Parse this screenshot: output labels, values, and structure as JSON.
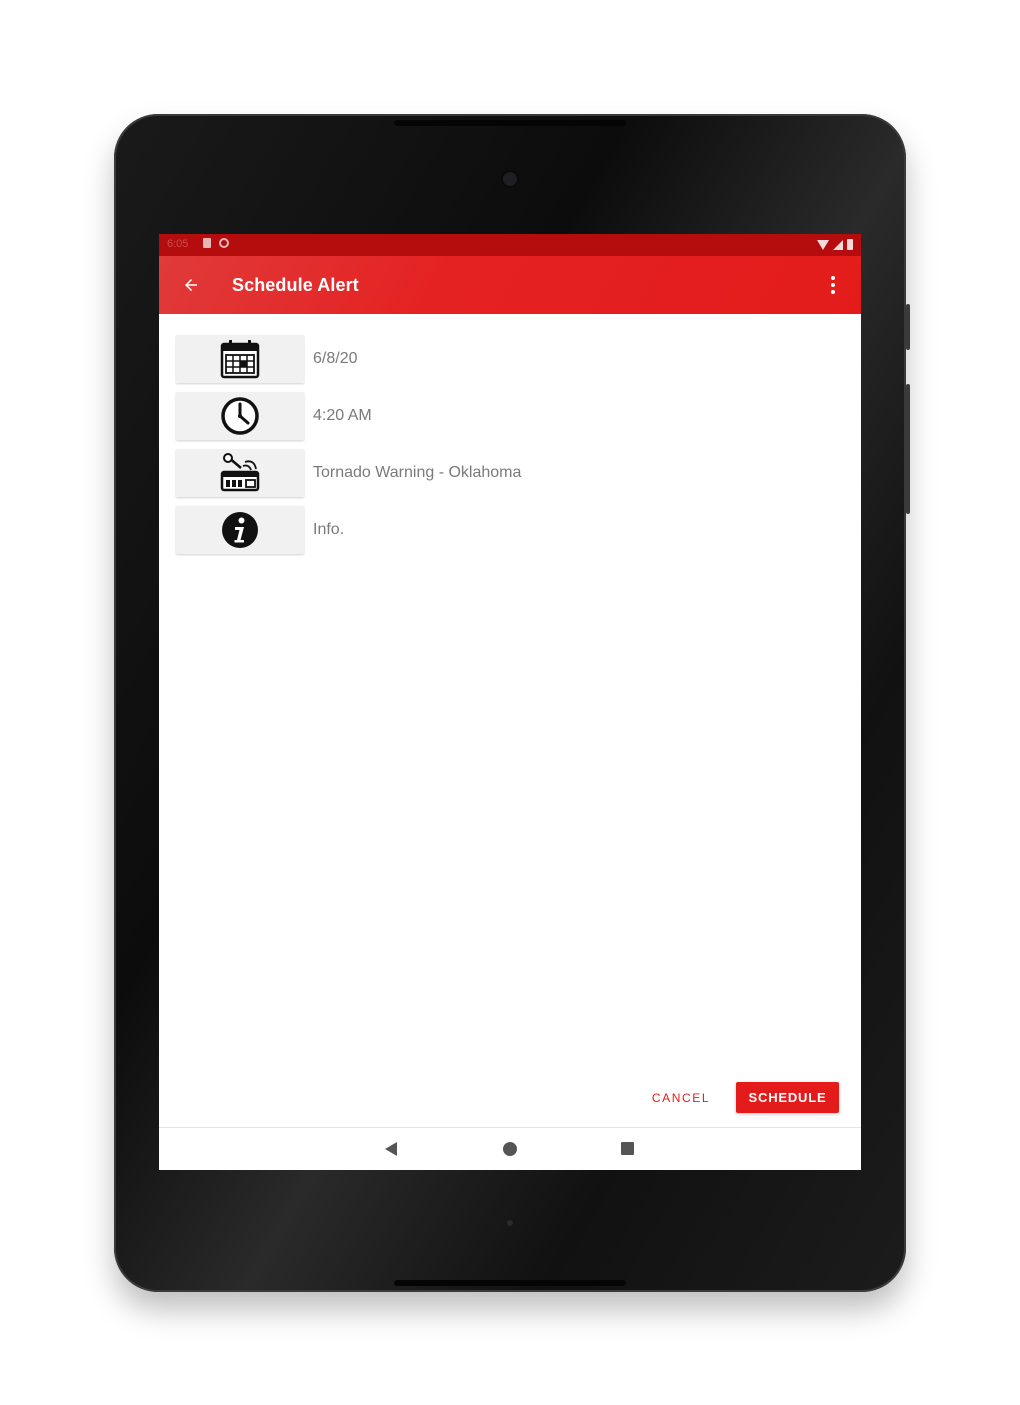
{
  "device": {
    "name": "tablet"
  },
  "status_bar": {
    "time": "6:05",
    "left_icons": [
      "sd-card-icon",
      "sync-icon"
    ],
    "right_icons": [
      "wifi-icon",
      "signal-icon",
      "battery-icon"
    ]
  },
  "app_bar": {
    "title": "Schedule Alert",
    "back_icon": "arrow-back-icon",
    "menu_icon": "more-vert-icon",
    "color": "#e31b1b",
    "status_color": "#b50d0d"
  },
  "fields": [
    {
      "icon": "calendar-icon",
      "value": "6/8/20"
    },
    {
      "icon": "clock-icon",
      "value": "4:20 AM"
    },
    {
      "icon": "weather-radio-icon",
      "value": "Tornado Warning - Oklahoma"
    },
    {
      "icon": "info-icon",
      "value": "Info."
    }
  ],
  "actions": {
    "cancel_label": "CANCEL",
    "schedule_label": "SCHEDULE",
    "accent": "#e31b1b"
  },
  "nav_bar": {
    "icons": [
      "nav-back-icon",
      "nav-home-icon",
      "nav-recents-icon"
    ]
  }
}
